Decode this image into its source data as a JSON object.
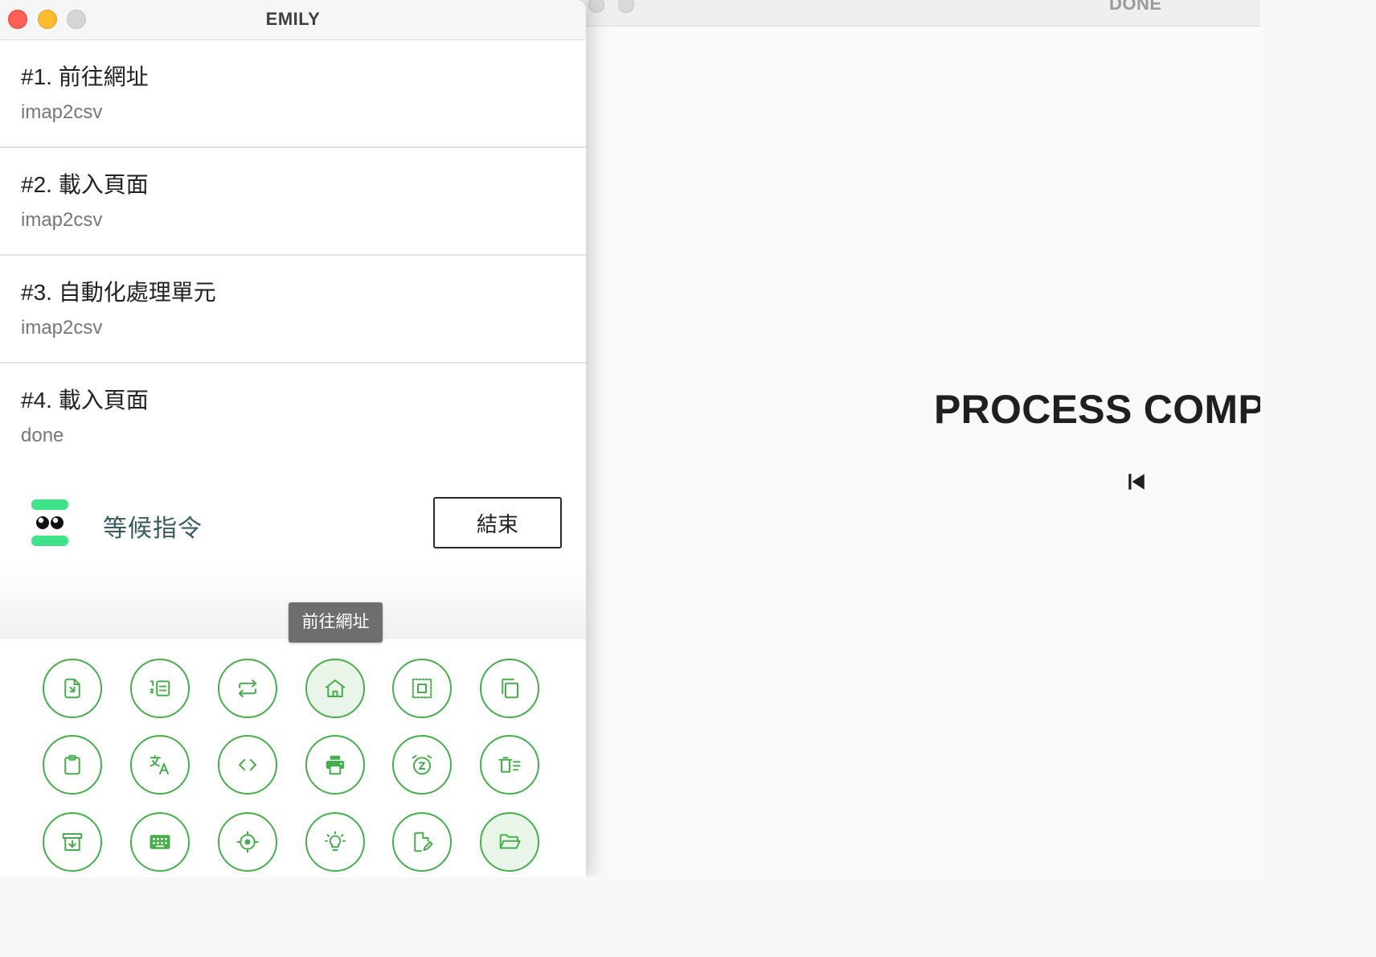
{
  "main_window": {
    "title": "EMILY"
  },
  "steps": [
    {
      "title": "#1. 前往網址",
      "subtitle": "imap2csv"
    },
    {
      "title": "#2. 載入頁面",
      "subtitle": "imap2csv"
    },
    {
      "title": "#3. 自動化處理單元",
      "subtitle": "imap2csv"
    },
    {
      "title": "#4. 載入頁面",
      "subtitle": "done"
    }
  ],
  "status": {
    "text": "等候指令",
    "end_button_label": "結束",
    "robot_icon": "robot-face-icon"
  },
  "tooltip": {
    "text": "前往網址"
  },
  "toolbar": {
    "accent_color": "#48ad4c",
    "active_fill": "#e9f5e9",
    "buttons": [
      {
        "icon": "file-import-icon",
        "active": false
      },
      {
        "icon": "list-numbered-icon",
        "active": false
      },
      {
        "icon": "repeat-icon",
        "active": false
      },
      {
        "icon": "home-icon",
        "active": true
      },
      {
        "icon": "select-area-icon",
        "active": false
      },
      {
        "icon": "copy-icon",
        "active": false
      },
      {
        "icon": "clipboard-icon",
        "active": false
      },
      {
        "icon": "translate-icon",
        "active": false
      },
      {
        "icon": "code-icon",
        "active": false
      },
      {
        "icon": "print-icon",
        "active": false
      },
      {
        "icon": "alarm-snooze-icon",
        "active": false
      },
      {
        "icon": "delete-list-icon",
        "active": false
      },
      {
        "icon": "archive-download-icon",
        "active": false
      },
      {
        "icon": "keyboard-icon",
        "active": false
      },
      {
        "icon": "crosshair-icon",
        "active": false
      },
      {
        "icon": "lightbulb-icon",
        "active": false
      },
      {
        "icon": "file-edit-icon",
        "active": false
      },
      {
        "icon": "folder-open-icon",
        "active": true
      }
    ]
  },
  "background_window": {
    "title": "DONE",
    "heading": "PROCESS COMPLETED",
    "skip_icon": "skip-previous-icon"
  }
}
